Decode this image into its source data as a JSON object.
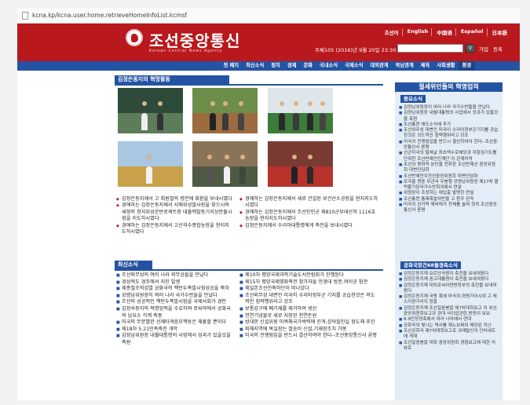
{
  "browser": {
    "url": "kcna.kp/kcna.user.home.retrieveHomeInfoList.kcmsf"
  },
  "header": {
    "title": "조선중앙통신",
    "subtitle": "Korean Central News Agency",
    "languages": [
      "조선어",
      "English",
      "中国语",
      "Español",
      "日本語"
    ],
    "date": "주체105 (2016)년 9월 20일 23:30",
    "join_label": "가입",
    "login_label": "등록",
    "search_placeholder": ""
  },
  "nav": {
    "items": [
      "첫 페지",
      "최신소식",
      "정치",
      "경제",
      "문화",
      "국내소식",
      "국제소식",
      "대외관계",
      "북남관계",
      "체육",
      "사회생활",
      "환경"
    ]
  },
  "leader_section": {
    "title": "김정은동지의 혁명활동",
    "photos": [
      "photo-1",
      "photo-2",
      "photo-3",
      "photo-4",
      "photo-5",
      "photo-6"
    ],
    "news_left": [
      "김정은동지께서 고 최원철의 령전에 화환을 보내시였다",
      "경애하는 김정은동지께서 서해위성발사장을 찾으시여 새형의 정지위성운반로케트용 대출력발동기지상분출시험을 지도하시였다",
      "경애하는 김정은동지께서 고산과수종합농장을 현지지도하시였다"
    ],
    "news_right": [
      "경애하는 김정은동지께서 새로 건설된 보건산소공장을 현지지도하시였다",
      "경애하는 김정은동지께서 조선인민군 제810군부대산하 1116호농장을 현지지도하시였다",
      "김정은동지께서 수리아대통령에게 축전을 보내시였다"
    ]
  },
  "latest_section": {
    "title": "최신소식",
    "left": [
      "조선외무성의 여러 나라 외무상들을 만났다",
      "경성혁도 경주에서 지진 발생",
      "제종철조직검열 공화국의 핵탄두폭발시험성공을 축하",
      "강령남위원장이 여러 나라 국가수반들을 만났다",
      "조선의 성공적인 핵탄두폭발시험을 국제사회가 경탄",
      "김정숙동지의 혁명업적을 수호하여 로씨야에서 공화국의 남요소 각계 축중",
      "미국의 무분별한 선제타격음모책동은 재홍할 뿐이다",
      "제18차 5.21민족축전 개막",
      "김정남위원장 내월대통령의 사업에서 성과가 있을것을 축원"
    ],
    "right": [
      "제10차 평양국제과학기술도서전람회가 진행된다",
      "제15차 평양국제영화축전 참가자들 만경대 방문,여러곳 참관",
      "체일본조선인축하단이 떠나갔다",
      "조선외무성 대변인 미국이 수리아정부군 기지를 공습한것은 의도적인 침략행위라고 강조",
      "보통강구에 폐기재를 제거하여 생산",
      "천연기념물로 새로 지정된 천연돈원",
      "방대한 신설위원 미목해국가박력에 진격,섬덕질인실 험도체 추진",
      "피해지역에 복실장는 철송이 신설,기재장조치 가봉",
      "미국의 전쟁림입을 반드시 결산하여야 한다--조선중앙통신사 론평"
    ]
  },
  "sidebar": {
    "heading": "절세위인들의 혁명업적",
    "important_title": "중요소식",
    "important": [
      "김정남위원장이 여러 나라 국가수반들을 만났다",
      "김정남위원장 내월대통령의 사업에서 성과가 있을것을 축원",
      "조선총련 애도소식에 추가",
      "조선외무성 대변인 미국이 수리아정부군기지를 공습한것은 의도적인 침략행위라고 강조",
      "미국의 전쟁림입을 반드시 결산하여야 한다--조선중앙통신사 론평",
      "선군미국의 떨쳐날 최초력수로해당과 저항권기도를 단죄한 조선반제인민계단 의 관계미적",
      "조선의 평화적 분단을 전취한 조선반제선 중앙위원회 대변인담화",
      "조선반제민주전선중앙위원회 대변인담화",
      "로국을 경중 무관국 우봉행 강령남위원장 제17차 블럭불가담국가수반회의에서 연설",
      "위원장이 조성하는 애입출 발명한 연설",
      "조선총련 통제폭발위반을 고 환주 완적",
      "미국의 선거력 재비레가 전체를 놀며 정치 조선중앙통신사 론평"
    ],
    "congrats_title": "공화국창건68돌경축소식",
    "congrats": [
      "김정은동지께 요르단국왕이 축전을 보내여왔다",
      "김정은동지께 꼼고대통령이 축전을 보내여왔다",
      "김정은동지께 대외로씨아연방정부의 축전을 보내여왔다",
      "김정은동지께 국왕 혹에 마국자,혁명가이시여 고 레스지영가리지 정흥",
      "김정은동지께 조선일중봉알 제7차대회보고 의 위선 중앙위원회보고과 관대 사이업관련,방증이 보보",
      "8.9민정정축에서 여러 나라에서 련대",
      "공화국의 빛나는 력사를 제노보찌려 해당된 지난",
      "조선공화국 제7차대회보고로 크레탈신의 인터네트에 게재",
      "조선일중봉알 대회 중앙위원회 경험보고에 대한 리뷰로"
    ]
  }
}
